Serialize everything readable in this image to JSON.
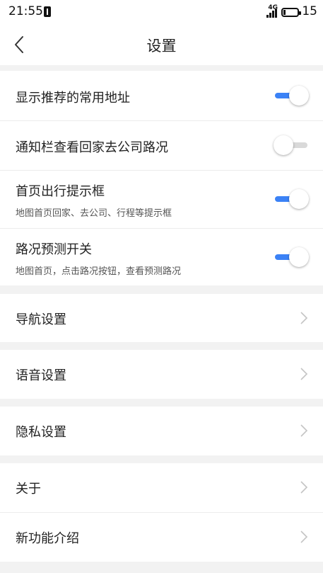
{
  "status": {
    "time": "21:55",
    "network": "4G",
    "battery": "15"
  },
  "nav": {
    "title": "设置"
  },
  "toggles": [
    {
      "title": "显示推荐的常用地址",
      "subtitle": "",
      "on": true
    },
    {
      "title": "通知栏查看回家去公司路况",
      "subtitle": "",
      "on": false
    },
    {
      "title": "首页出行提示框",
      "subtitle": "地图首页回家、去公司、行程等提示框",
      "on": true
    },
    {
      "title": "路况预测开关",
      "subtitle": "地图首页，点击路况按钮，查看预测路况",
      "on": true
    }
  ],
  "links": {
    "navigation": "导航设置",
    "voice": "语音设置",
    "privacy": "隐私设置",
    "about": "关于",
    "new_features": "新功能介绍"
  },
  "colors": {
    "accent": "#3b82f6",
    "toggle_off": "#d9d9d9",
    "background": "#f2f2f2"
  }
}
